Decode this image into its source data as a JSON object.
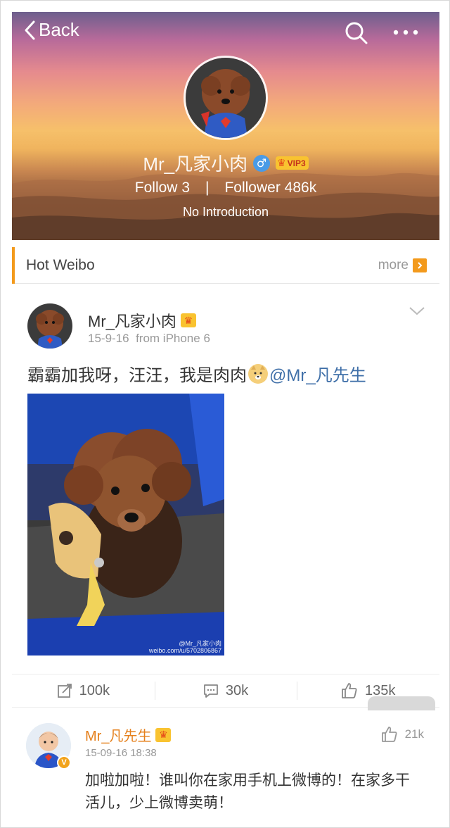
{
  "header": {
    "back_label": "Back",
    "name": "Mr_凡家小肉",
    "gender_symbol": "♂",
    "vip_level": "VIP3",
    "follow_label": "Follow",
    "follow_count": "3",
    "separator": "|",
    "follower_label": "Follower",
    "follower_count": "486k",
    "introduction": "No Introduction"
  },
  "hot_section": {
    "title": "Hot Weibo",
    "more_label": "more"
  },
  "post": {
    "author": "Mr_凡家小肉",
    "date": "15-9-16",
    "source": "from iPhone 6",
    "text": "霸霸加我呀，汪汪，我是肉肉",
    "mention": "@Mr_凡先生",
    "watermark_line1": "@Mr_凡家小肉",
    "watermark_line2": "weibo.com/u/5702806867"
  },
  "actions": {
    "repost_count": "100k",
    "comment_count": "30k",
    "like_count": "135k"
  },
  "comment": {
    "author": "Mr_凡先生",
    "time": "15-09-16 18:38",
    "like_count": "21k",
    "text": "加啦加啦！谁叫你在家用手机上微博的！在家多干活儿，少上微博卖萌！"
  },
  "colors": {
    "accent_orange": "#f39a1c",
    "mention_blue": "#3f6fa8",
    "comment_name_orange": "#e5801c",
    "vip_gold": "#f9c330"
  },
  "icons": [
    "back-chevron-icon",
    "search-icon",
    "more-dots-icon",
    "gender-male-icon",
    "vip-crown-icon",
    "more-arrow-icon",
    "chevron-down-icon",
    "repost-icon",
    "comment-icon",
    "like-icon",
    "verified-badge-icon"
  ]
}
